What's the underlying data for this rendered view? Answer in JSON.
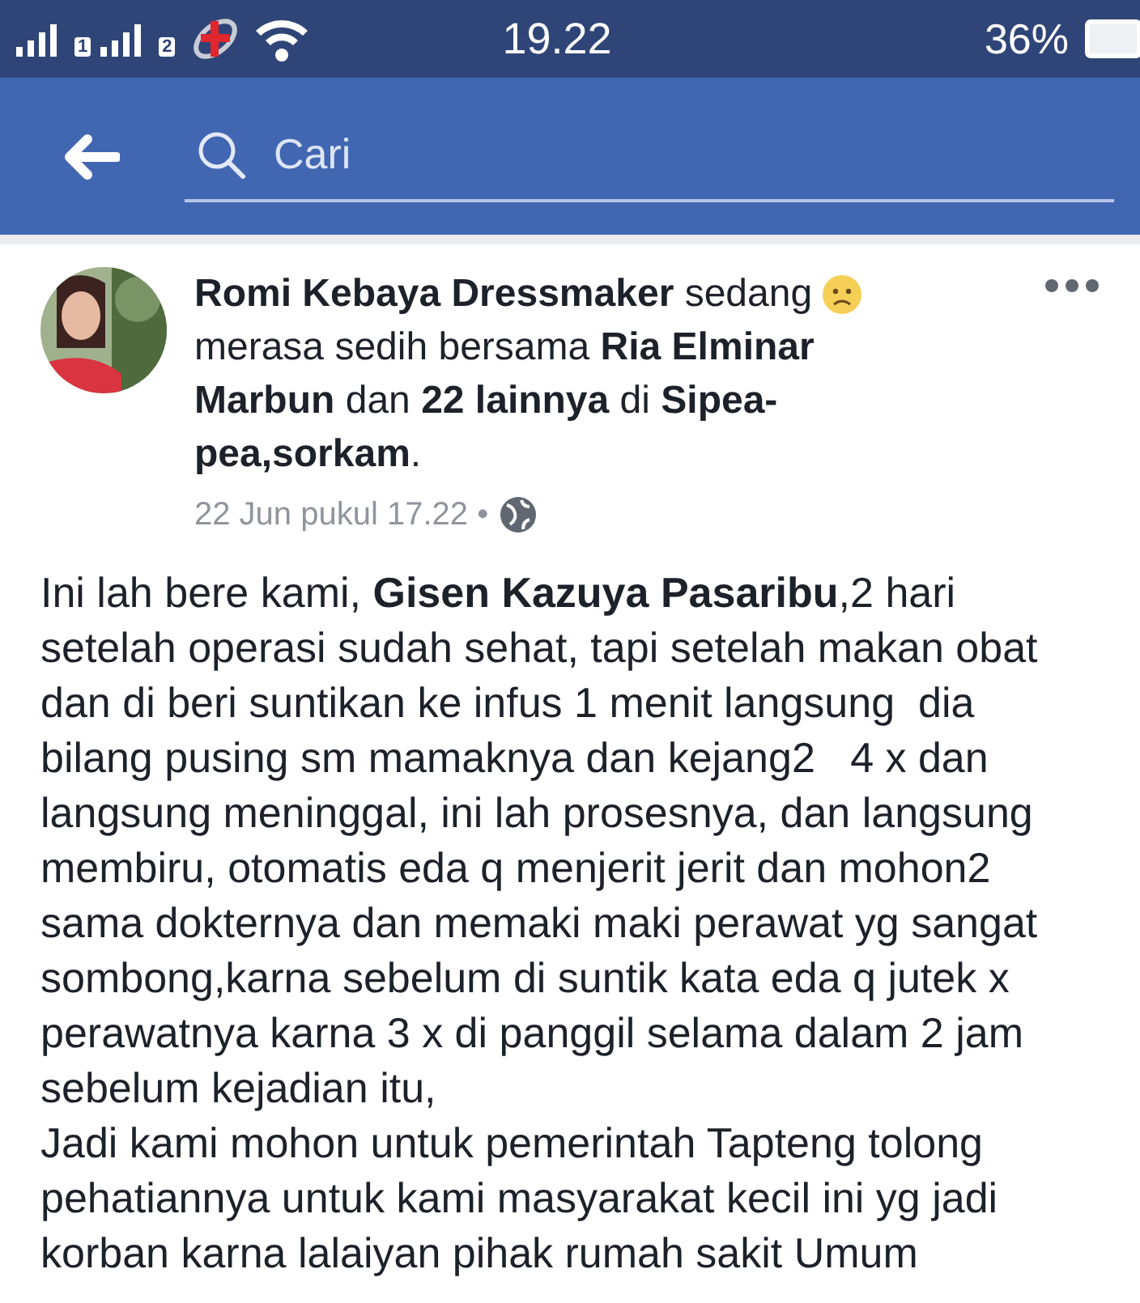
{
  "status_bar": {
    "sims": [
      "1",
      "2"
    ],
    "time": "19.22",
    "battery": "36%"
  },
  "search": {
    "placeholder": "Cari"
  },
  "post": {
    "header_first_line": "**Romi Kebaya Dressmaker** sedang",
    "header_rest": [
      "merasa sedih bersama **Ria Elminar**",
      "**Marbun** dan **22 lainnya** di **Sipea-**",
      "**pea,sorkam**."
    ],
    "timestamp": "22 Jun pukul 17.22 •",
    "paragraphs": [
      [
        "Ini lah bere kami, **Gisen Kazuya Pasaribu**,2 hari",
        "setelah operasi sudah sehat, tapi setelah makan obat",
        "dan di beri suntikan ke infus 1 menit langsung  dia",
        "bilang pusing sm mamaknya dan kejang2   4 x dan",
        "langsung meninggal, ini lah prosesnya, dan langsung",
        "membiru, otomatis eda q menjerit jerit dan mohon2",
        "sama dokternya dan memaki maki perawat yg sangat",
        "sombong,karna sebelum di suntik kata eda q jutek x",
        "perawatnya karna 3 x di panggil selama dalam 2 jam",
        "sebelum kejadian itu,"
      ],
      [
        "Jadi kami mohon untuk pemerintah Tapteng tolong",
        "pehatiannya untuk kami masyarakat kecil ini yg jadi",
        "korban karna lalaiyan pihak rumah sakit Umum"
      ]
    ]
  }
}
